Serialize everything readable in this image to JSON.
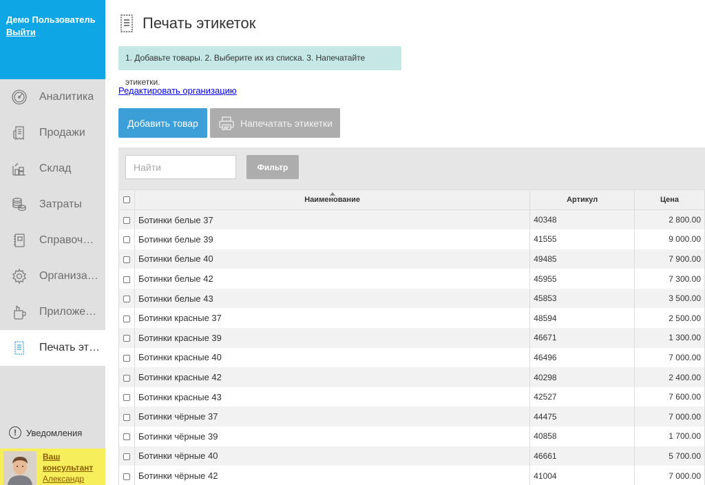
{
  "user": {
    "name": "Демо Пользователь",
    "logout": "Выйти"
  },
  "nav": [
    {
      "label": "Аналитика",
      "icon": "gauge-icon",
      "active": false
    },
    {
      "label": "Продажи",
      "icon": "receipt-icon",
      "active": false
    },
    {
      "label": "Склад",
      "icon": "warehouse-icon",
      "active": false
    },
    {
      "label": "Затраты",
      "icon": "coins-icon",
      "active": false
    },
    {
      "label": "Справочники",
      "icon": "book-icon",
      "active": false
    },
    {
      "label": "Организация",
      "icon": "gear-icon",
      "active": false
    },
    {
      "label": "Приложения",
      "icon": "apps-icon",
      "active": false
    },
    {
      "label": "Печать этикеток",
      "icon": "label-print-icon",
      "active": true
    }
  ],
  "notifications": {
    "label": "Уведомления",
    "icon": "alert-icon"
  },
  "consultant": {
    "line1": "Ваш",
    "line2": "консультант",
    "name": "Александр"
  },
  "page": {
    "title": "Печать этикеток"
  },
  "hint": "1. Добавьте товары. 2. Выберите их из списка. 3. Напечатайте этикетки.",
  "edit_org_link": "Редактировать организацию",
  "buttons": {
    "add": "Добавить товар",
    "print": "Напечатать этикетки",
    "filter": "Фильтр"
  },
  "search": {
    "placeholder": "Найти",
    "value": ""
  },
  "table": {
    "headers": {
      "name": "Наименование",
      "article": "Артикул",
      "price": "Цена"
    },
    "rows": [
      {
        "name": "Ботинки белые 37",
        "article": "40348",
        "price": "2 800.00"
      },
      {
        "name": "Ботинки белые 39",
        "article": "41555",
        "price": "9 000.00"
      },
      {
        "name": "Ботинки белые 40",
        "article": "49485",
        "price": "7 900.00"
      },
      {
        "name": "Ботинки белые 42",
        "article": "45955",
        "price": "7 300.00"
      },
      {
        "name": "Ботинки белые 43",
        "article": "45853",
        "price": "3 500.00"
      },
      {
        "name": "Ботинки красные 37",
        "article": "48594",
        "price": "2 500.00"
      },
      {
        "name": "Ботинки красные 39",
        "article": "46671",
        "price": "1 300.00"
      },
      {
        "name": "Ботинки красные 40",
        "article": "46496",
        "price": "7 000.00"
      },
      {
        "name": "Ботинки красные 42",
        "article": "40298",
        "price": "2 400.00"
      },
      {
        "name": "Ботинки красные 43",
        "article": "42527",
        "price": "7 600.00"
      },
      {
        "name": "Ботинки чёрные 37",
        "article": "44475",
        "price": "7 000.00"
      },
      {
        "name": "Ботинки чёрные 39",
        "article": "40858",
        "price": "1 700.00"
      },
      {
        "name": "Ботинки чёрные 40",
        "article": "46661",
        "price": "5 700.00"
      },
      {
        "name": "Ботинки чёрные 42",
        "article": "41004",
        "price": "7 000.00"
      }
    ]
  },
  "colors": {
    "sidebar_header": "#0ea6e4",
    "primary_button": "#3d9fd8",
    "disabled_button": "#adadad",
    "hint_bg": "#c5e8e6",
    "consultant_bg": "#f7ee5c"
  }
}
